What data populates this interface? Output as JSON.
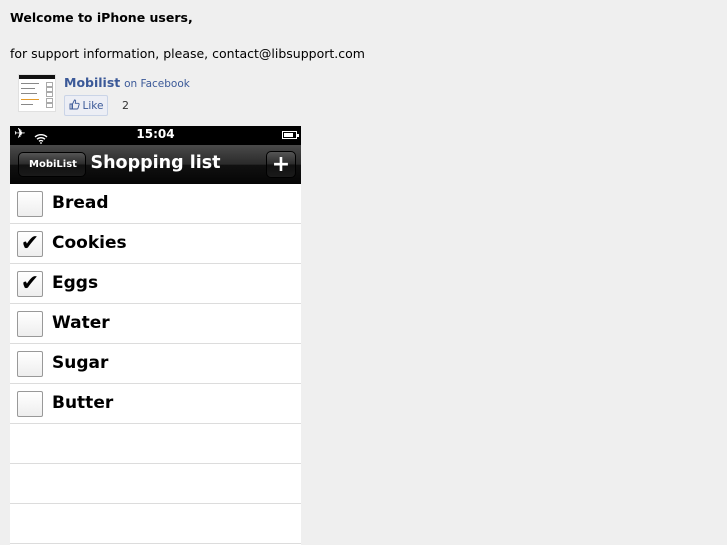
{
  "welcome_text": "Welcome to iPhone users,",
  "support_text": "for support information, please, contact@libsupport.com",
  "facebook": {
    "page_name": "Mobilist",
    "suffix": "on Facebook",
    "like_label": "Like",
    "like_count": "2"
  },
  "phone": {
    "status_time": "15:04",
    "back_label": "MobiList",
    "title": "Shopping list",
    "add_label": "+"
  },
  "items": [
    {
      "label": "Bread",
      "checked": false
    },
    {
      "label": "Cookies",
      "checked": true
    },
    {
      "label": "Eggs",
      "checked": true
    },
    {
      "label": "Water",
      "checked": false
    },
    {
      "label": "Sugar",
      "checked": false
    },
    {
      "label": "Butter",
      "checked": false
    }
  ],
  "empty_rows": 3
}
